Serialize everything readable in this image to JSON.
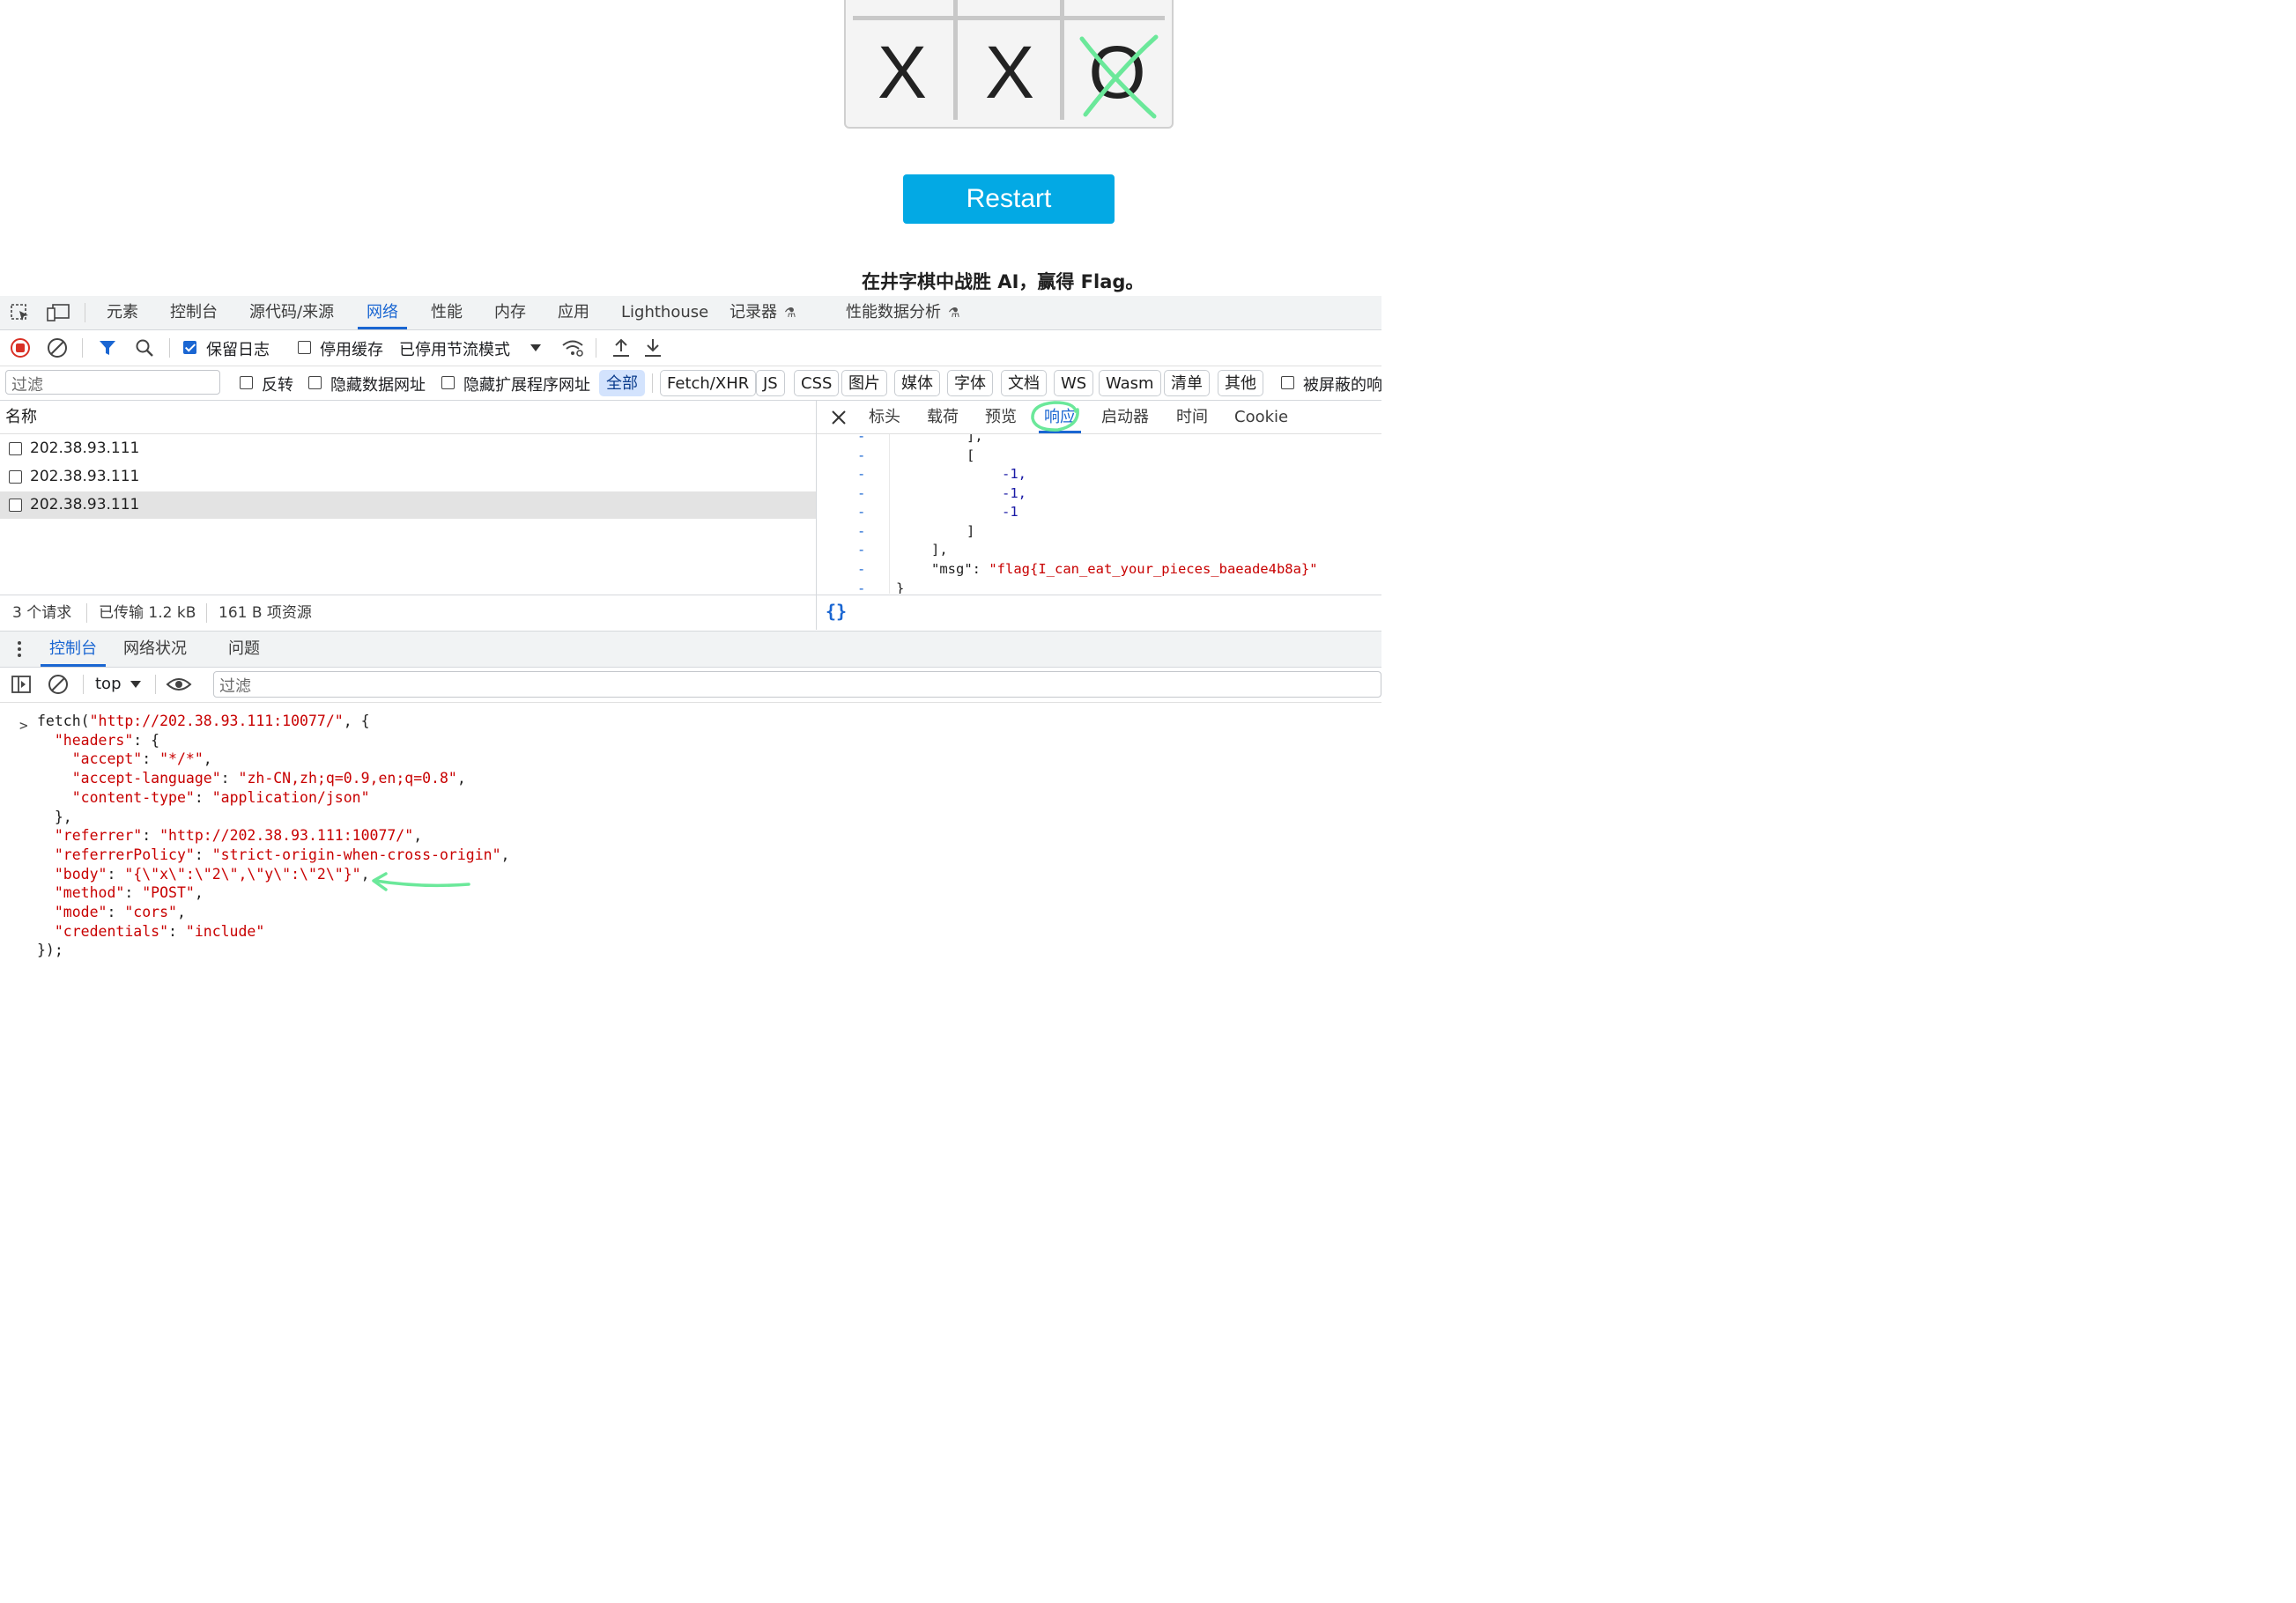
{
  "page": {
    "board": [
      "X",
      "X",
      "O"
    ],
    "restart_label": "Restart",
    "hint": "在井字棋中战胜 AI，赢得 Flag。"
  },
  "devtools": {
    "tabs": [
      "元素",
      "控制台",
      "源代码/来源",
      "网络",
      "性能",
      "内存",
      "应用",
      "Lighthouse",
      "记录器",
      "性能数据分析"
    ],
    "active_tab": "网络",
    "toolbar": {
      "preserve_log": "保留日志",
      "preserve_log_checked": true,
      "disable_cache": "停用缓存",
      "throttle": "已停用节流模式"
    },
    "filter": {
      "placeholder": "过滤",
      "invert": "反转",
      "hide_data_urls": "隐藏数据网址",
      "hide_ext_urls": "隐藏扩展程序网址",
      "types": [
        "全部",
        "Fetch/XHR",
        "JS",
        "CSS",
        "图片",
        "媒体",
        "字体",
        "文档",
        "WS",
        "Wasm",
        "清单",
        "其他"
      ],
      "selected_type": "全部",
      "blocked": "被屏蔽的响"
    },
    "requests": {
      "header": "名称",
      "rows": [
        "202.38.93.111",
        "202.38.93.111",
        "202.38.93.111"
      ],
      "selected_index": 2
    },
    "detail_tabs": [
      "标头",
      "载荷",
      "预览",
      "响应",
      "启动器",
      "时间",
      "Cookie"
    ],
    "active_detail_tab": "响应",
    "response_lines": [
      "],",
      "[",
      "-1,",
      "-1,",
      "-1",
      "]",
      "],",
      "\"msg\": ",
      "\"flag{I_can_eat_your_pieces_baeade4b8a}\"",
      "}"
    ],
    "gutter_mark": "-",
    "status": {
      "requests": "3 个请求",
      "transferred": "已传输 1.2 kB",
      "resources": "161 B 项资源"
    },
    "pretty_print": "{}",
    "drawer_tabs": [
      "控制台",
      "网络状况",
      "问题"
    ],
    "active_drawer_tab": "控制台",
    "context": "top",
    "console_filter_placeholder": "过滤",
    "console_lines": [
      "fetch(\"http://202.38.93.111:10077/\", {",
      "  \"headers\": {",
      "    \"accept\": \"*/*\",",
      "    \"accept-language\": \"zh-CN,zh;q=0.9,en;q=0.8\",",
      "    \"content-type\": \"application/json\"",
      "  },",
      "  \"referrer\": \"http://202.38.93.111:10077/\",",
      "  \"referrerPolicy\": \"strict-origin-when-cross-origin\",",
      "  \"body\": \"{\\\"x\\\":\\\"2\\\",\\\"y\\\":\\\"2\\\"}\",",
      "  \"method\": \"POST\",",
      "  \"mode\": \"cors\",",
      "  \"credentials\": \"include\"",
      "});"
    ],
    "prompt": ">"
  },
  "colors": {
    "accent": "#1a66d2",
    "restart": "#03a9e4",
    "annotation": "#6be89a",
    "string": "#c80000",
    "number": "#1a1aa6"
  }
}
